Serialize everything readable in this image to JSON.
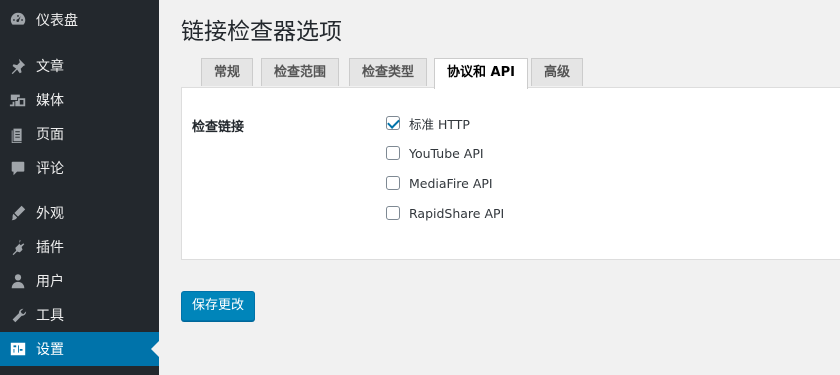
{
  "sidebar": {
    "items": [
      {
        "label": "仪表盘",
        "icon": "dashboard-icon"
      },
      {
        "label": "文章",
        "icon": "pin-icon"
      },
      {
        "label": "媒体",
        "icon": "media-icon"
      },
      {
        "label": "页面",
        "icon": "pages-icon"
      },
      {
        "label": "评论",
        "icon": "comment-icon"
      },
      {
        "label": "外观",
        "icon": "appearance-icon"
      },
      {
        "label": "插件",
        "icon": "plugin-icon"
      },
      {
        "label": "用户",
        "icon": "user-icon"
      },
      {
        "label": "工具",
        "icon": "wrench-icon"
      },
      {
        "label": "设置",
        "icon": "settings-icon",
        "active": true
      }
    ]
  },
  "main": {
    "title": "链接检查器选项",
    "tabs": [
      {
        "label": "常规"
      },
      {
        "label": "检查范围"
      },
      {
        "label": "检查类型"
      },
      {
        "label": "协议和 API",
        "active": true
      },
      {
        "label": "高级"
      }
    ],
    "section_label": "检查链接",
    "options": [
      {
        "label": "标准 HTTP",
        "checked": true
      },
      {
        "label": "YouTube API",
        "checked": false
      },
      {
        "label": "MediaFire API",
        "checked": false
      },
      {
        "label": "RapidShare API",
        "checked": false
      }
    ],
    "save_label": "保存更改"
  },
  "colors": {
    "sidebar_bg": "#23282d",
    "active_bg": "#0073aa",
    "button_bg": "#0085ba"
  }
}
